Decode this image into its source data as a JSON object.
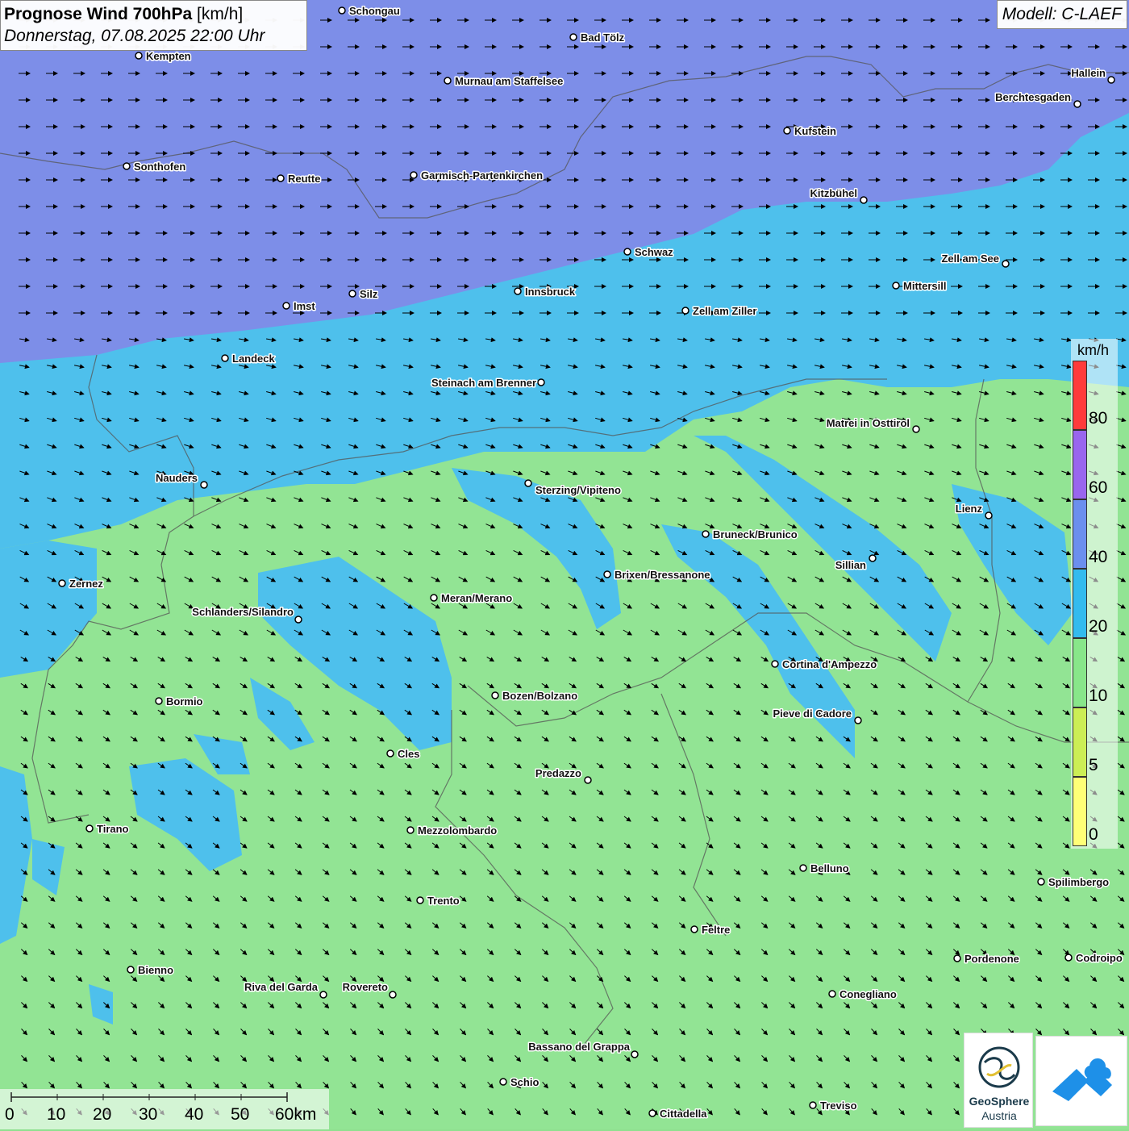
{
  "title": {
    "main": "Prognose Wind 700hPa",
    "unit": "[km/h]",
    "subtitle": "Donnerstag, 07.08.2025 22:00 Uhr"
  },
  "model_label": "Modell: C-LAEF",
  "legend": {
    "unit": "km/h",
    "labels": [
      "80",
      "60",
      "40",
      "20",
      "10",
      "5",
      "0"
    ],
    "bins": [
      {
        "color": "#ff3b3b"
      },
      {
        "color": "#9966ee"
      },
      {
        "color": "#6b8fee"
      },
      {
        "color": "#33bbee"
      },
      {
        "color": "#88e68a"
      },
      {
        "color": "#ccee55"
      },
      {
        "color": "#ffff77"
      }
    ]
  },
  "scale_bar": {
    "ticks": [
      "0",
      "10",
      "20",
      "30",
      "40",
      "50",
      "60km"
    ]
  },
  "logos": {
    "geosphere_line1": "GeoSphere",
    "geosphere_line2": "Austria"
  },
  "colors": {
    "strong_wind": "#7d8ee8",
    "moderate_wind": "#4ec0ec",
    "light_wind": "#92e494"
  },
  "cities": [
    {
      "name": "Schongau"
    },
    {
      "name": "Bad Tölz"
    },
    {
      "name": "Kempten"
    },
    {
      "name": "Murnau am Staffelsee"
    },
    {
      "name": "Hallein"
    },
    {
      "name": "Berchtesgaden"
    },
    {
      "name": "Kufstein"
    },
    {
      "name": "Sonthofen"
    },
    {
      "name": "Reutte"
    },
    {
      "name": "Garmisch-Partenkirchen"
    },
    {
      "name": "Kitzbühel"
    },
    {
      "name": "Schwaz"
    },
    {
      "name": "Zell am See"
    },
    {
      "name": "Mittersill"
    },
    {
      "name": "Innsbruck"
    },
    {
      "name": "Silz"
    },
    {
      "name": "Imst"
    },
    {
      "name": "Zell am Ziller"
    },
    {
      "name": "Landeck"
    },
    {
      "name": "Steinach am Brenner"
    },
    {
      "name": "Matrei in Osttirol"
    },
    {
      "name": "Nauders"
    },
    {
      "name": "Sterzing/Vipiteno"
    },
    {
      "name": "Lienz"
    },
    {
      "name": "Bruneck/Brunico"
    },
    {
      "name": "Sillian"
    },
    {
      "name": "Brixen/Bressanone"
    },
    {
      "name": "Zernez"
    },
    {
      "name": "Meran/Merano"
    },
    {
      "name": "Schlanders/Silandro"
    },
    {
      "name": "Cortina d'Ampezzo"
    },
    {
      "name": "Bozen/Bolzano"
    },
    {
      "name": "Bormio"
    },
    {
      "name": "Pieve di Cadore"
    },
    {
      "name": "Cles"
    },
    {
      "name": "Predazzo"
    },
    {
      "name": "Tirano"
    },
    {
      "name": "Mezzolombardo"
    },
    {
      "name": "Belluno"
    },
    {
      "name": "Spilimbergo"
    },
    {
      "name": "Trento"
    },
    {
      "name": "Feltre"
    },
    {
      "name": "Pordenone"
    },
    {
      "name": "Codroipo"
    },
    {
      "name": "Bienno"
    },
    {
      "name": "Riva del Garda"
    },
    {
      "name": "Rovereto"
    },
    {
      "name": "Conegliano"
    },
    {
      "name": "Bassano del Grappa"
    },
    {
      "name": "Schio"
    },
    {
      "name": "Treviso"
    },
    {
      "name": "Cittadella"
    }
  ]
}
